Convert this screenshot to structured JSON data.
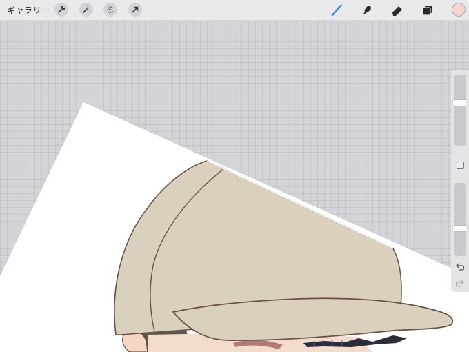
{
  "topbar": {
    "gallery_label": "ギャラリー",
    "left_tools": [
      "wrench-icon",
      "magic-wand-icon",
      "selection-icon",
      "transform-arrow-icon"
    ],
    "right_tools": [
      "brush-icon",
      "smudge-icon",
      "eraser-icon",
      "layers-icon"
    ],
    "active_tool": "brush-icon",
    "accent_color": "#2f7ff0",
    "current_color": "#f7d5cf"
  },
  "sidebar": {
    "size_slider_level": 0.12,
    "opacity_slider_level": 0.6,
    "icons": [
      "modify-square-icon",
      "undo-icon",
      "redo-icon"
    ]
  },
  "canvas": {
    "paper_color": "#ffffff",
    "grid_background_color": "#d3d4d7",
    "cap_color": "#d9d0bd",
    "line_color": "#6e5048"
  }
}
